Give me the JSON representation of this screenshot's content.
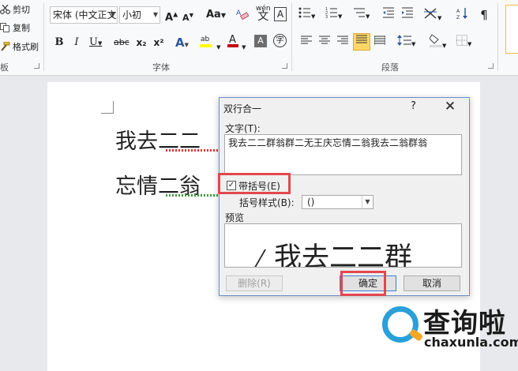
{
  "ribbon": {
    "clipboard": {
      "cut_label": "剪切",
      "copy_label": "复制",
      "format_painter_label": "格式刷",
      "group_label_partial": "板"
    },
    "font": {
      "font_name": "宋体 (中文正文",
      "font_size": "小初",
      "group_label": "字体",
      "change_case_label": "Aa",
      "wen_icon": "wén",
      "A_box": "A",
      "bold": "B",
      "italic": "I",
      "underline": "U",
      "strike": "abc",
      "subscript": "x₂",
      "superscript": "x²"
    },
    "paragraph": {
      "group_label": "段落"
    },
    "accent_color": "#2b579a",
    "highlight_color": "#ffff00",
    "font_color": "#c00000"
  },
  "document": {
    "line1": "我去二二",
    "line2": "忘情二翁"
  },
  "dialog": {
    "title": "双行合一",
    "help": "?",
    "close": "✕",
    "text_label": "文字(T):",
    "text_value": "我去二二群翁群二无王庆忘情二翁我去二翁群翁",
    "checkbox_checked": true,
    "checkbox_mark": "✓",
    "bracket_label": "带括号(E)",
    "bracket_style_label": "括号样式(B):",
    "bracket_style_value": "()",
    "preview_label": "预览",
    "preview_text": "我去二二群",
    "delete_button": "删除(R)",
    "ok_button": "确定",
    "cancel_button": "取消",
    "highlight_color": "#e2474f"
  },
  "watermark": {
    "brand": "查询啦",
    "url": "chaxunla.com",
    "ring_color": "#2aa0d8",
    "tail_color": "#f5a623"
  }
}
